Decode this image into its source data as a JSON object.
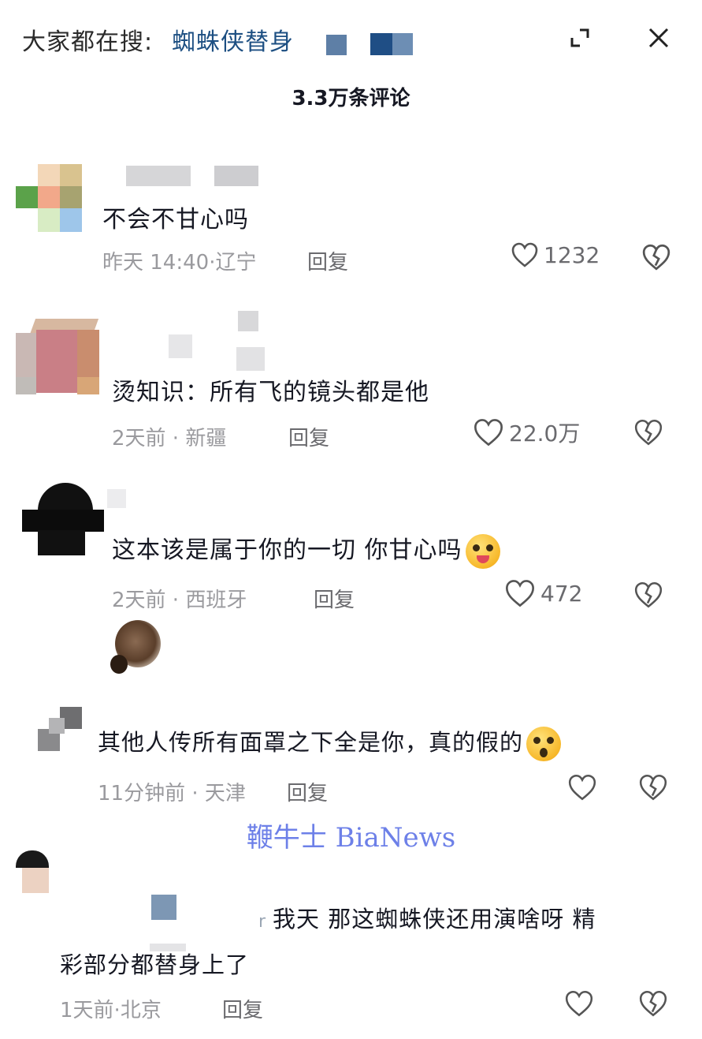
{
  "header": {
    "search_prefix": "大家都在搜:",
    "search_term": "蜘蛛侠替身",
    "expand_icon": "expand-icon",
    "close_icon": "close-icon"
  },
  "comment_count": "3.3万条评论",
  "comments": [
    {
      "text": "不会不甘心吗",
      "time": "昨天 14:40",
      "location": "辽宁",
      "reply_label": "回复",
      "likes": "1232"
    },
    {
      "text": "烫知识：所有飞的镜头都是他",
      "time": "2天前",
      "location": "新疆",
      "reply_label": "回复",
      "likes": "22.0万"
    },
    {
      "text": "这本该是属于你的一切 你甘心吗",
      "emoji": "tongue-emoji",
      "time": "2天前",
      "location": "西班牙",
      "reply_label": "回复",
      "likes": "472"
    },
    {
      "text": "其他人传所有面罩之下全是你，真的假的",
      "emoji": "shocked-emoji",
      "time": "11分钟前",
      "location": "天津",
      "reply_label": "回复",
      "likes": ""
    },
    {
      "text_line1": "我天 那这蜘蛛侠还用演啥呀 精",
      "text_line2": "彩部分都替身上了",
      "time": "1天前",
      "location": "北京",
      "reply_label": "回复",
      "likes": ""
    }
  ],
  "watermark": "鞭牛士 BiaNews",
  "colors": {
    "search_term": "#1d4f82",
    "watermark": "#6d80e8",
    "meta": "#9a9a9e"
  }
}
